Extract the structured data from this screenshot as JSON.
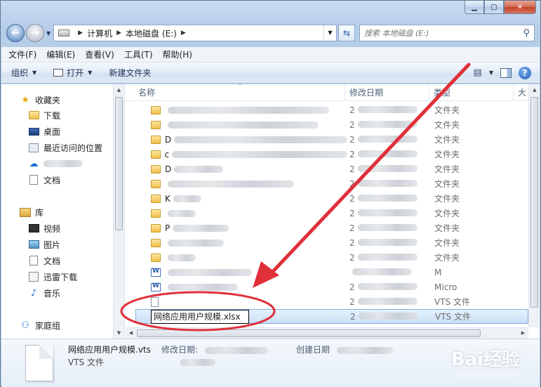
{
  "address": {
    "crumbs": [
      "计算机",
      "本地磁盘 (E:)"
    ]
  },
  "search": {
    "placeholder": "搜索 本地磁盘 (E:)"
  },
  "menu": [
    "文件(F)",
    "编辑(E)",
    "查看(V)",
    "工具(T)",
    "帮助(H)"
  ],
  "commands": {
    "organize": "组织",
    "open": "打开",
    "new_folder": "新建文件夹"
  },
  "nav": {
    "favorites": "收藏夹",
    "downloads": "下载",
    "desktop": "桌面",
    "recent": "最近访问的位置",
    "docs1": "文档",
    "library": "库",
    "videos": "视频",
    "pictures": "图片",
    "docs2": "文档",
    "thunder": "迅雷下载",
    "music": "音乐",
    "homegroup": "家庭组"
  },
  "columns": {
    "name": "名称",
    "date": "修改日期",
    "type": "类型",
    "size": "大"
  },
  "files": [
    {
      "kind": "folder",
      "name": "",
      "date": "2",
      "type": "文件夹"
    },
    {
      "kind": "folder",
      "name": "",
      "date": "2",
      "type": "文件夹"
    },
    {
      "kind": "folder",
      "name": "D",
      "date": "2",
      "type": "文件夹"
    },
    {
      "kind": "folder",
      "name": "c",
      "date": "2",
      "type": "文件夹"
    },
    {
      "kind": "folder",
      "name": "D",
      "date": "2",
      "type": "文件夹"
    },
    {
      "kind": "folder",
      "name": "",
      "date": "2",
      "type": "文件夹"
    },
    {
      "kind": "folder",
      "name": "K",
      "date": "2",
      "type": "文件夹"
    },
    {
      "kind": "folder",
      "name": "",
      "date": "2",
      "type": "文件夹"
    },
    {
      "kind": "folder",
      "name": "P",
      "date": "2",
      "type": "文件夹"
    },
    {
      "kind": "folder",
      "name": "",
      "date": "2",
      "type": "文件夹"
    },
    {
      "kind": "folder",
      "name": "",
      "date": "2",
      "type": "文件夹"
    },
    {
      "kind": "word",
      "name": "",
      "date": "",
      "type": "M"
    },
    {
      "kind": "word",
      "name": "",
      "date": "2",
      "type": "Micro"
    },
    {
      "kind": "vts",
      "name": "",
      "date": "2",
      "type": "VTS 文件"
    },
    {
      "kind": "vts",
      "name": "",
      "date": "2",
      "type": "VTS 文件"
    }
  ],
  "rename_value": "网络应用用户规模.xlsx",
  "details": {
    "filename": "网络应用用户规模.vts",
    "filetype": "VTS 文件",
    "modified_label": "修改日期:",
    "created_label": "创建日期"
  },
  "watermark": {
    "text": "Bai经验",
    "url": "jingyan.baidu.com"
  },
  "colors": {
    "annotation": "#e0303a",
    "selection": "#cce4f7"
  }
}
